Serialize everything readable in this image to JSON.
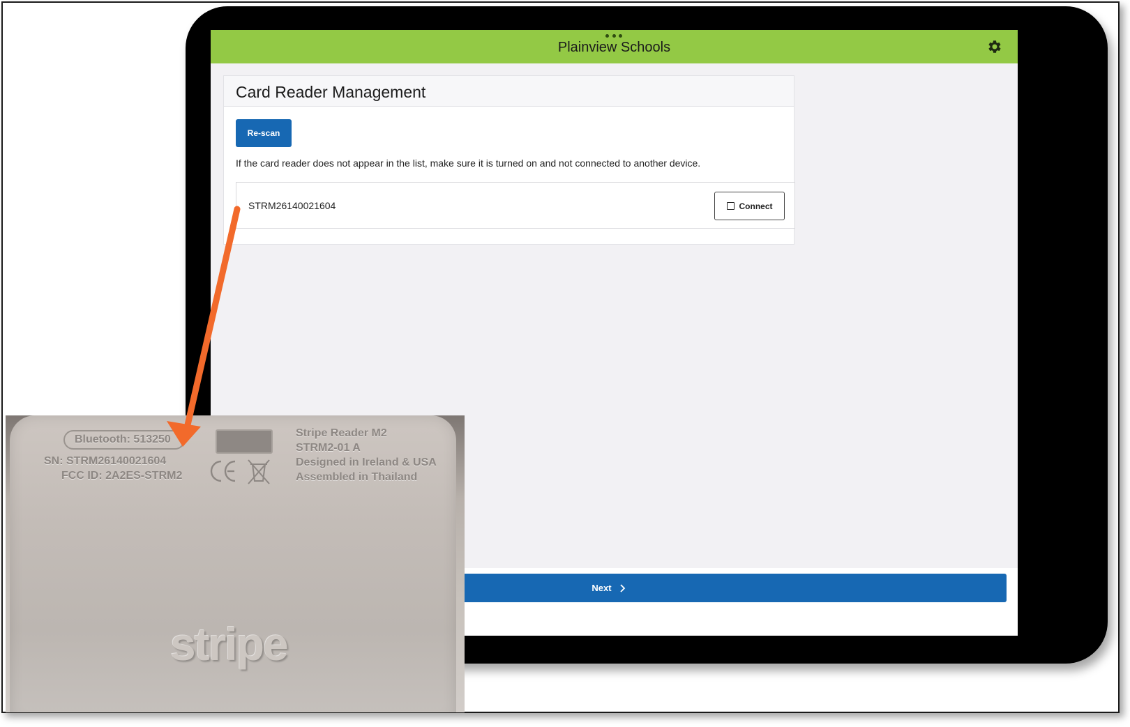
{
  "app": {
    "header_title": "Plainview Schools",
    "settings_icon": "gear-icon",
    "accent_color": "#93c945",
    "button_color": "#1768b3"
  },
  "panel": {
    "title": "Card Reader Management",
    "rescan_label": "Re-scan",
    "help_text": "If the card reader does not appear in the list, make sure it is turned on and not connected to another device.",
    "readers": [
      {
        "serial": "STRM26140021604",
        "connect_label": "Connect"
      }
    ]
  },
  "footer": {
    "next_label": "Next",
    "next_icon": "chevron-right-icon"
  },
  "photo": {
    "bluetooth": "Bluetooth: 513250",
    "sn": "SN: STRM26140021604",
    "fcc": "FCC ID: 2A2ES-STRM2",
    "model_name": "Stripe Reader M2",
    "model_code": "STRM2-01  A",
    "designed": "Designed in Ireland & USA",
    "assembled": "Assembled in Thailand",
    "brand": "stripe",
    "cert_icons": [
      "ce-mark-icon",
      "weee-bin-icon"
    ]
  },
  "annotation": {
    "arrow_color": "#f26a2b"
  }
}
